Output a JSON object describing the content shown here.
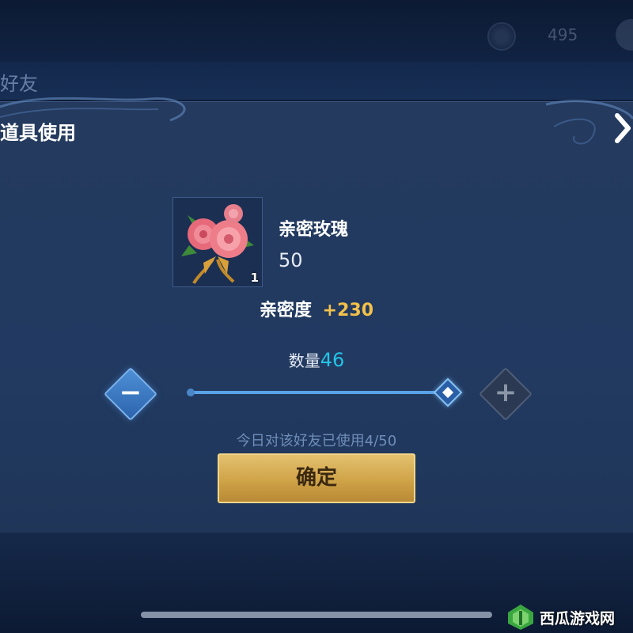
{
  "top_bar": {
    "currency_value": "495",
    "icons": [
      "coin-icon",
      "avatar"
    ]
  },
  "background_header": {
    "title": "好友"
  },
  "dialog": {
    "title": "道具使用",
    "close_icon": "close-chevron-icon",
    "item": {
      "name": "亲密玫瑰",
      "value": "50",
      "count": "1",
      "icon": "rose-bouquet-icon"
    },
    "intimacy": {
      "label": "亲密度",
      "bonus": "+230"
    },
    "quantity": {
      "label": "数量",
      "value": "46",
      "slider_fraction": 1.0
    },
    "buttons": {
      "minus_icon": "minus-icon",
      "plus_icon": "plus-icon",
      "confirm_label": "确定"
    },
    "usage_text": "今日对该好友已使用4/50"
  },
  "watermark": {
    "text": "西瓜游戏网"
  },
  "colors": {
    "accent_gold": "#f3c14a",
    "quantity_cyan": "#25c3e6",
    "dialog_bg": "#223a61"
  }
}
